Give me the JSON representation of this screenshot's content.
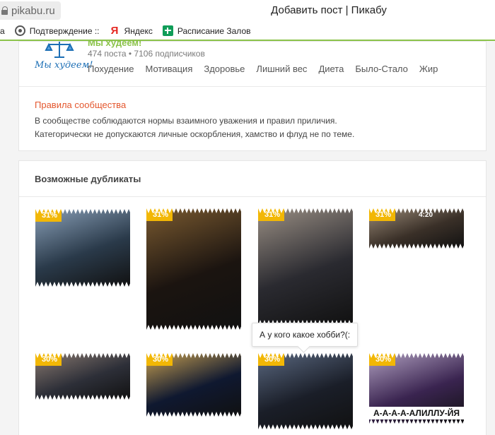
{
  "browser": {
    "url": "pikabu.ru",
    "window_title": "Добавить пост | Пикабу",
    "bookmarks": [
      {
        "label": "а",
        "icon": "none"
      },
      {
        "label": "Подтверждение ::",
        "icon": "wheel-icon"
      },
      {
        "label": "Яндекс",
        "icon": "yandex-icon"
      },
      {
        "label": "Расписание Залов",
        "icon": "sheets-icon"
      }
    ]
  },
  "community": {
    "name": "Мы худеем!",
    "logo_text": "Мы худеем!",
    "stats": "474 поста • 7106 подписчиков",
    "tags": [
      "Похудение",
      "Мотивация",
      "Здоровье",
      "Лишний вес",
      "Диета",
      "Было-Стало",
      "Жир"
    ],
    "rules_title": "Правила сообщества",
    "rules_line1": "В сообществе соблюдаются нормы взаимного уважения и правил приличия.",
    "rules_line2": "Категорически не допускаются личные оскорбления, хамство и флуд не по теме."
  },
  "duplicates": {
    "title": "Возможные дубликаты",
    "items": [
      {
        "match": "31%",
        "colors": [
          "#2a3a4a",
          "#8aa0b8"
        ]
      },
      {
        "match": "31%",
        "colors": [
          "#1b1410",
          "#7a5a30"
        ]
      },
      {
        "match": "31%",
        "colors": [
          "#2a2a30",
          "#9a8f84"
        ]
      },
      {
        "match": "31%",
        "colors": [
          "#3a3028",
          "#9a8a78"
        ],
        "extra": "4:20"
      },
      {
        "match": "30%",
        "colors": [
          "#2d2f38",
          "#8a7a70"
        ]
      },
      {
        "match": "30%",
        "colors": [
          "#0f1830",
          "#c8a050"
        ]
      },
      {
        "match": "30%",
        "colors": [
          "#1a1e28",
          "#5a6880"
        ]
      },
      {
        "match": "30%",
        "colors": [
          "#3a2450",
          "#b0a0c0"
        ],
        "caption": "А-А-А-А-АЛИЛЛУ-ЙЯ"
      }
    ],
    "tooltip": "А у кого какое хобби?(:"
  },
  "colors": {
    "accent_green": "#8bc34a",
    "badge": "#f2b705",
    "rules_title": "#e4572e"
  }
}
